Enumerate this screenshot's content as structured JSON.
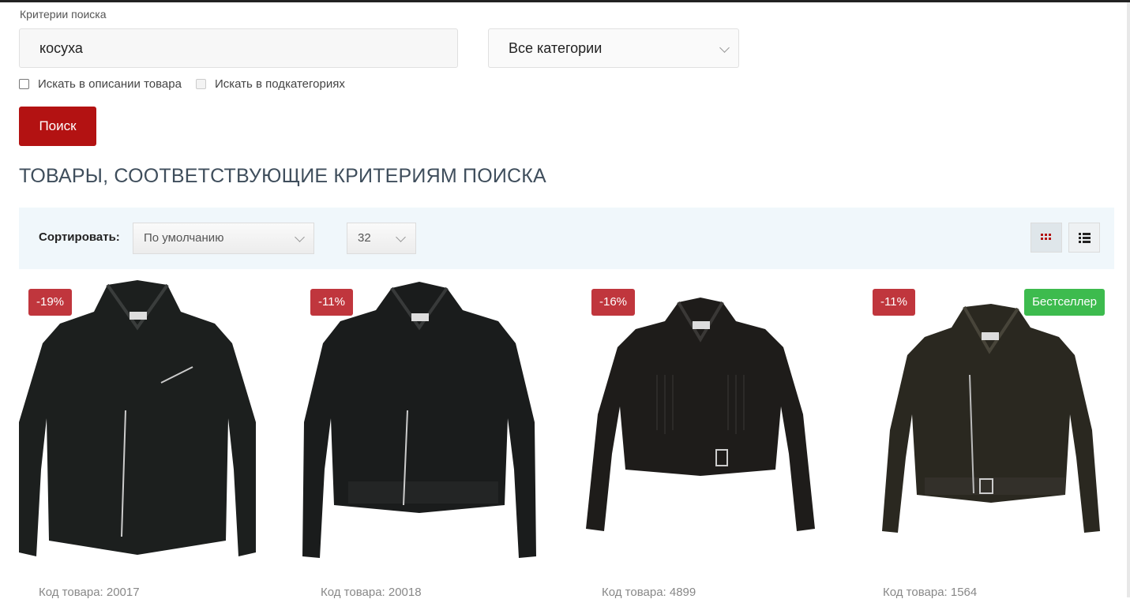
{
  "search": {
    "criteria_label": "Критерии поиска",
    "query": "косуха",
    "category": "Все категории",
    "option_description": "Искать в описании товара",
    "option_subcategories": "Искать в подкатегориях",
    "button": "Поиск"
  },
  "results": {
    "title": "ТОВАРЫ, СООТВЕТСТВУЮЩИЕ КРИТЕРИЯМ ПОИСКА",
    "sort_label": "Сортировать:",
    "sort_value": "По умолчанию",
    "limit_value": "32",
    "products": [
      {
        "discount": "-19%",
        "code": "Код товара: 20017",
        "jacket_color": "#1c1f1e"
      },
      {
        "discount": "-11%",
        "code": "Код товара: 20018",
        "jacket_color": "#1a1c1c"
      },
      {
        "discount": "-16%",
        "code": "Код товара: 4899",
        "jacket_color": "#1e1c1a"
      },
      {
        "discount": "-11%",
        "bestseller": "Бестселлер",
        "code": "Код товара: 1564",
        "jacket_color": "#2a2820"
      }
    ]
  },
  "colors": {
    "search_button": "#b31212",
    "sale_badge": "#c0363d",
    "bestseller_badge": "#3dbb4e",
    "toolbar_bg": "#f0f7fb"
  }
}
